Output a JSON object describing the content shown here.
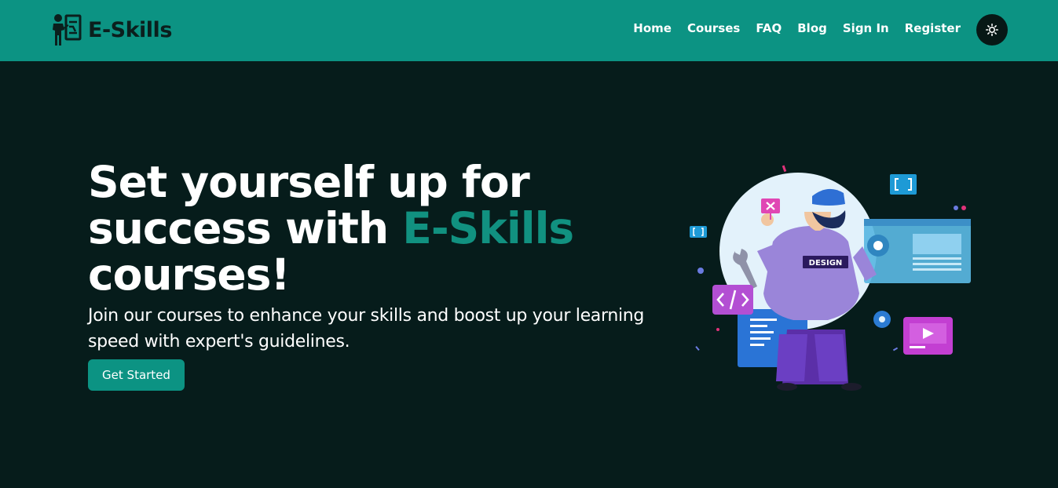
{
  "brand": {
    "name": "E-Skills"
  },
  "nav": {
    "links": [
      "Home",
      "Courses",
      "FAQ",
      "Blog",
      "Sign In",
      "Register"
    ],
    "theme_icon": "sun-icon"
  },
  "hero": {
    "title_line1": "Set yourself up for",
    "title_line2_prefix": "success with ",
    "title_line2_accent": "E-Skills",
    "title_line3": "courses!",
    "subtitle": "Join our courses to enhance your skills and boost up your learning speed with expert's guidelines.",
    "cta_label": "Get Started",
    "illustration_badge": "DESIGN"
  },
  "colors": {
    "navbar": "#0c9383",
    "background": "#061c1b",
    "accent": "#119180",
    "button": "#0c9383",
    "text": "#ffffff"
  }
}
